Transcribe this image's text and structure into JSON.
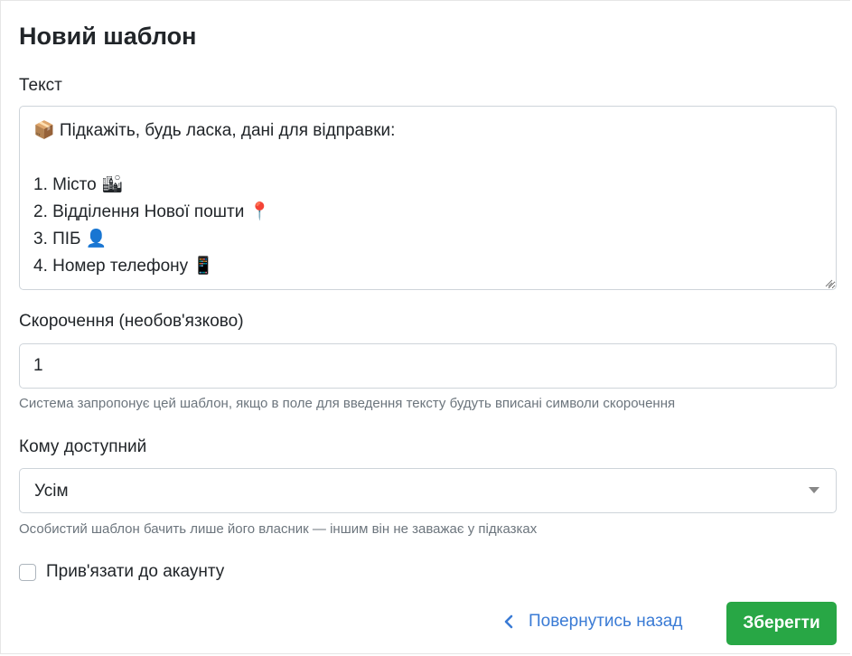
{
  "page": {
    "title": "Новий шаблон"
  },
  "form": {
    "text_label": "Текст",
    "text_value": "📦 Підкажіть, будь ласка, дані для відправки:\n\n1. Місто 🏙\n2. Відділення Нової пошти 📍\n3. ПІБ 👤\n4. Номер телефону 📱",
    "shortcut_label": "Скорочення (необов'язково)",
    "shortcut_value": "1",
    "shortcut_help": "Система запропонує цей шаблон, якщо в поле для введення тексту будуть вписані символи скорочення",
    "access_label": "Кому доступний",
    "access_selected": "Усім",
    "access_help": "Особистий шаблон бачить лише його власник — іншим він не заважає у підказках",
    "bind_account_label": "Прив'язати до акаунту",
    "bind_account_checked": false
  },
  "actions": {
    "back_label": "Повернутись назад",
    "save_label": "Зберегти"
  },
  "colors": {
    "primary_link": "#3a7bd5",
    "save_button": "#28a745",
    "help_text": "#6c757d"
  }
}
